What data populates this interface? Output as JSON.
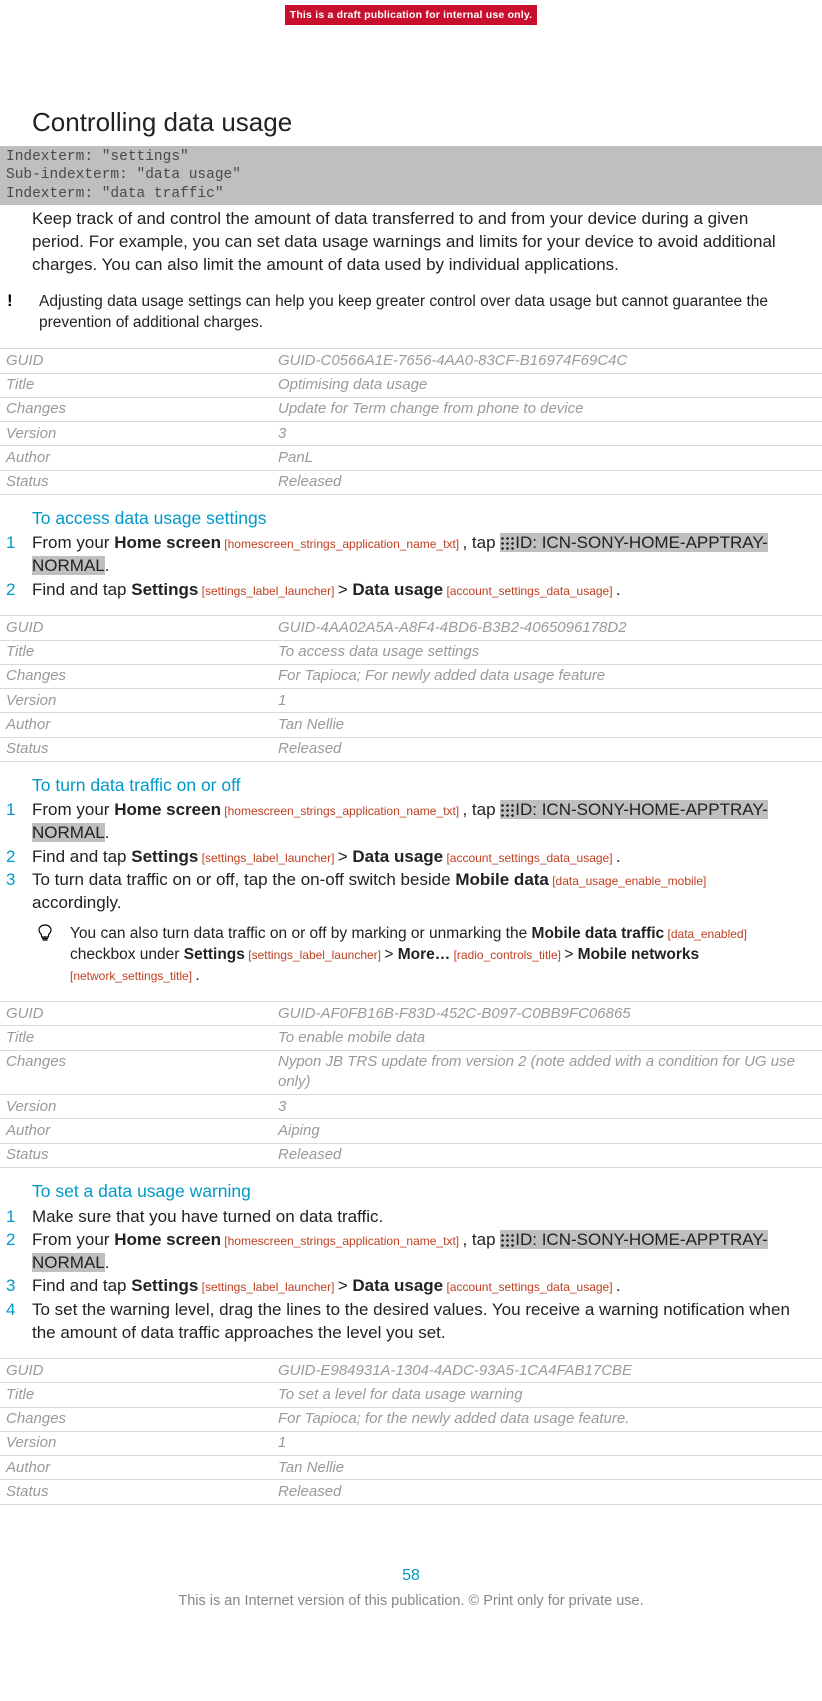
{
  "banner": "This is a draft publication for internal use only.",
  "title": "Controlling data usage",
  "indexterm": {
    "l1": "Indexterm: \"settings\"",
    "l2": "Sub-indexterm: \"data usage\"",
    "l3": "Indexterm: \"data traffic\""
  },
  "intro": "Keep track of and control the amount of data transferred to and from your device during a given period. For example, you can set data usage warnings and limits for your device to avoid additional charges. You can also limit the amount of data used by individual applications.",
  "note1": "Adjusting data usage settings can help you keep greater control over data usage but cannot guarantee the prevention of additional charges.",
  "meta_labels": {
    "guid": "GUID",
    "title": "Title",
    "changes": "Changes",
    "version": "Version",
    "author": "Author",
    "status": "Status"
  },
  "meta1": {
    "guid": "GUID-C0566A1E-7656-4AA0-83CF-B16974F69C4C",
    "title": "Optimising data usage",
    "changes": "Update for Term change from phone to device",
    "version": "3",
    "author": "PanL",
    "status": "Released"
  },
  "sec1_heading": "To access data usage settings",
  "strings": {
    "from_your": "From your ",
    "home_screen": "Home screen",
    "hs_tag": " [homescreen_strings_application_name_txt] ",
    "tap": ", tap ",
    "icn": "ID: ICN-SONY-HOME-APPTRAY-NORMAL",
    "period": ".",
    "find_tap": "Find and tap ",
    "settings": "Settings",
    "settings_tag": " [settings_label_launcher] ",
    "gt": " > ",
    "data_usage": "Data usage",
    "data_usage_tag": " [account_settings_data_usage] ",
    "space_period": " ."
  },
  "meta2": {
    "guid": "GUID-4AA02A5A-A8F4-4BD6-B3B2-4065096178D2",
    "title": "To access data usage settings",
    "changes": "For Tapioca; For newly added data usage feature",
    "version": "1",
    "author": "Tan Nellie",
    "status": "Released"
  },
  "sec2_heading": "To turn data traffic on or off",
  "sec2_step3": {
    "pre": "To turn data traffic on or off, tap the on-off switch beside ",
    "mobile_data": "Mobile data",
    "md_tag": " [data_usage_enable_mobile] ",
    "post": "accordingly."
  },
  "tip1": {
    "pre": "You can also turn data traffic on or off by marking or unmarking the ",
    "mdt": "Mobile data traffic",
    "mdt_tag": " [data_enabled] ",
    "mid1": "checkbox under ",
    "settings": "Settings",
    "settings_tag": " [settings_label_launcher] ",
    "gt": " > ",
    "more": "More…",
    "more_tag": " [radio_controls_title] ",
    "mobile_networks": "Mobile networks",
    "mn_tag": " [network_settings_title] ",
    "end": "."
  },
  "meta3": {
    "guid": "GUID-AF0FB16B-F83D-452C-B097-C0BB9FC06865",
    "title": "To enable mobile data",
    "changes": "Nypon JB TRS update from version 2 (note added with a condition for UG use only)",
    "version": "3",
    "author": "Aiping",
    "status": "Released"
  },
  "sec3_heading": "To set a data usage warning",
  "sec3_step1": "Make sure that you have turned on data traffic.",
  "sec3_step4": "To set the warning level, drag the lines to the desired values. You receive a warning notification when the amount of data traffic approaches the level you set.",
  "meta4": {
    "guid": "GUID-E984931A-1304-4ADC-93A5-1CA4FAB17CBE",
    "title": "To set a level for data usage warning",
    "changes": "For Tapioca; for the newly added data usage feature.",
    "version": "1",
    "author": "Tan Nellie",
    "status": "Released"
  },
  "page_number": "58",
  "footer": "This is an Internet version of this publication. © Print only for private use."
}
